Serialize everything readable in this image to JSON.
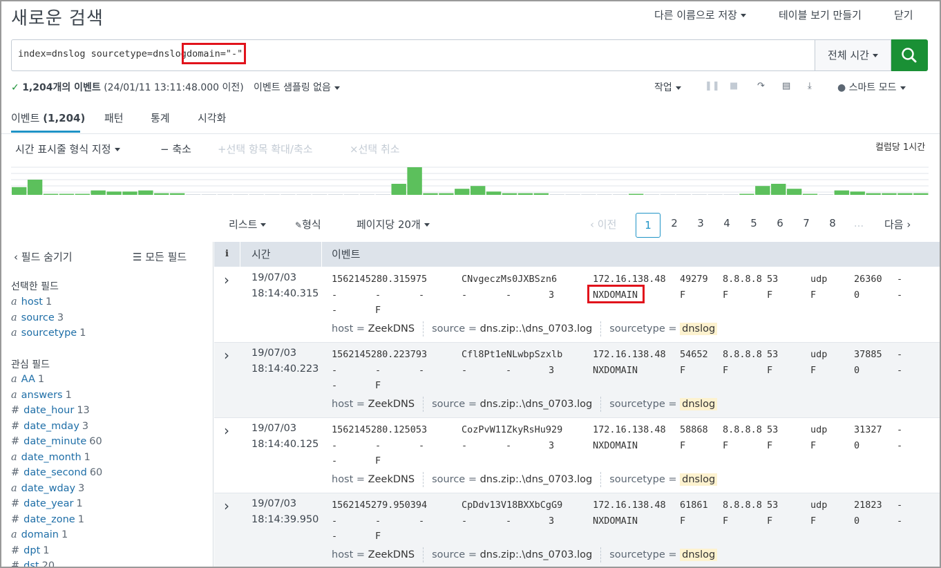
{
  "page": {
    "title": "새로운 검색"
  },
  "topmenu": {
    "save_as": "다른 이름으로 저장",
    "create_table": "테이블 보기 만들기",
    "close": "닫기"
  },
  "search": {
    "query_prefix": "index=dnslog sourcetype=dnslog ",
    "query_highlight": "domain=\"-\"",
    "time_range": "전체 시간"
  },
  "status": {
    "count": "1,204개의 이벤트",
    "time_note": "(24/01/11 13:11:48.000 이전)",
    "sampling": "이벤트 샘플링 없음",
    "job": "작업",
    "mode": "스마트 모드"
  },
  "tabs": [
    {
      "label": "이벤트",
      "count": "(1,204)"
    },
    {
      "label": "패턴"
    },
    {
      "label": "통계"
    },
    {
      "label": "시각화"
    }
  ],
  "timeline": {
    "format": "시간 표시줄 형식 지정",
    "zoom_out": "축소",
    "zoom_sel": "선택 항목 확대/축소",
    "deselect": "선택 취소",
    "per_column": "컬럼당 1시간",
    "bars": [
      0.28,
      0.55,
      0.02,
      0.02,
      0.02,
      0.16,
      0.12,
      0.12,
      0.16,
      0.06,
      0.06,
      0.0,
      0.0,
      0.0,
      0.0,
      0.0,
      0.0,
      0.0,
      0.0,
      0.0,
      0.0,
      0.0,
      0.0,
      0.0,
      0.4,
      1.0,
      0.06,
      0.06,
      0.22,
      0.32,
      0.12,
      0.06,
      0.06,
      0.06,
      0.0,
      0.0,
      0.0,
      0.0,
      0.0,
      0.02,
      0.0,
      0.0,
      0.0,
      0.0,
      0.0,
      0.0,
      0.02,
      0.32,
      0.4,
      0.22,
      0.02,
      0.0,
      0.16,
      0.12,
      0.06,
      0.06,
      0.06,
      0.06
    ]
  },
  "pager": {
    "list": "리스트",
    "format": "형식",
    "per_page": "페이지당 20개",
    "prev": "이전",
    "pages": [
      "1",
      "2",
      "3",
      "4",
      "5",
      "6",
      "7",
      "8",
      "..."
    ],
    "next": "다음"
  },
  "sidebar": {
    "hide": "필드 숨기기",
    "all": "모든 필드",
    "selected_label": "선택한 필드",
    "selected": [
      {
        "t": "a",
        "name": "host",
        "count": "1"
      },
      {
        "t": "a",
        "name": "source",
        "count": "3"
      },
      {
        "t": "a",
        "name": "sourcetype",
        "count": "1"
      }
    ],
    "interesting_label": "관심 필드",
    "interesting": [
      {
        "t": "a",
        "name": "AA",
        "count": "1"
      },
      {
        "t": "a",
        "name": "answers",
        "count": "1"
      },
      {
        "t": "#",
        "name": "date_hour",
        "count": "13"
      },
      {
        "t": "#",
        "name": "date_mday",
        "count": "3"
      },
      {
        "t": "#",
        "name": "date_minute",
        "count": "60"
      },
      {
        "t": "a",
        "name": "date_month",
        "count": "1"
      },
      {
        "t": "#",
        "name": "date_second",
        "count": "60"
      },
      {
        "t": "a",
        "name": "date_wday",
        "count": "3"
      },
      {
        "t": "#",
        "name": "date_year",
        "count": "1"
      },
      {
        "t": "#",
        "name": "date_zone",
        "count": "1"
      },
      {
        "t": "a",
        "name": "domain",
        "count": "1"
      },
      {
        "t": "#",
        "name": "dpt",
        "count": "1"
      },
      {
        "t": "#",
        "name": "dst",
        "count": "20"
      }
    ]
  },
  "table": {
    "col_i": "i",
    "col_time": "시간",
    "col_event": "이벤트",
    "rows": [
      {
        "date": "19/07/03",
        "time": "18:14:40.315",
        "ts": "1562145280.315975",
        "uid": "CNvgeczMs0JXBSzn6",
        "src": "172.16.138.48",
        "port": "49279",
        "dst": "8.8.8.8",
        "dport": "53",
        "proto": "udp",
        "trans": "26360",
        "rcode": "NXDOMAIN",
        "boxed": true
      },
      {
        "date": "19/07/03",
        "time": "18:14:40.223",
        "ts": "1562145280.223793",
        "uid": "Cfl8Pt1eNLwbpSzxlb",
        "src": "172.16.138.48",
        "port": "54652",
        "dst": "8.8.8.8",
        "dport": "53",
        "proto": "udp",
        "trans": "37885",
        "rcode": "NXDOMAIN",
        "boxed": false
      },
      {
        "date": "19/07/03",
        "time": "18:14:40.125",
        "ts": "1562145280.125053",
        "uid": "CozPvW11ZkyRsHu929",
        "src": "172.16.138.48",
        "port": "58868",
        "dst": "8.8.8.8",
        "dport": "53",
        "proto": "udp",
        "trans": "31327",
        "rcode": "NXDOMAIN",
        "boxed": false
      },
      {
        "date": "19/07/03",
        "time": "18:14:39.950",
        "ts": "1562145279.950394",
        "uid": "CpDdv13V18BXXbCgG9",
        "src": "172.16.138.48",
        "port": "61861",
        "dst": "8.8.8.8",
        "dport": "53",
        "proto": "udp",
        "trans": "21823",
        "rcode": "NXDOMAIN",
        "boxed": false
      }
    ],
    "dash": "-",
    "f": "F",
    "zero": "0",
    "three": "3",
    "meta": {
      "host_k": "host =",
      "host_v": "ZeekDNS",
      "source_k": "source =",
      "source_v": "dns.zip:.\\dns_0703.log",
      "st_k": "sourcetype =",
      "st_v": "dnslog"
    }
  }
}
